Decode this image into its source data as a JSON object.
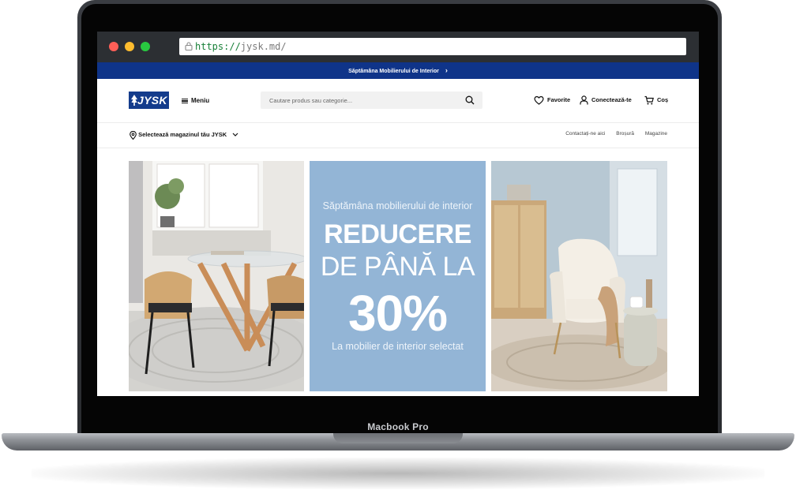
{
  "browser": {
    "url_protocol": "https://",
    "url_host": "jysk.md/"
  },
  "device": {
    "label": "Macbook Pro"
  },
  "promo_bar": {
    "text": "Săptămâna Mobilierului de Interior",
    "chevron": "›"
  },
  "header": {
    "logo_text": "JYSK",
    "menu_label": "Meniu",
    "search_placeholder": "Cautare produs sau categorie...",
    "favorites_label": "Favorite",
    "login_label": "Conectează-te",
    "cart_label": "Coș"
  },
  "subnav": {
    "store_select_label": "Selectează magazinul tău JYSK",
    "links": [
      "Contactați-ne aici",
      "Broșură",
      "Magazine"
    ]
  },
  "hero": {
    "subtitle": "Săptămâna mobilierului de interior",
    "line1": "REDUCERE",
    "line2": "DE PÂNĂ LA",
    "percent": "30%",
    "footer": "La mobilier de interior selectat"
  },
  "colors": {
    "brand_blue": "#0f3489",
    "promo_card": "#93b5d6"
  }
}
